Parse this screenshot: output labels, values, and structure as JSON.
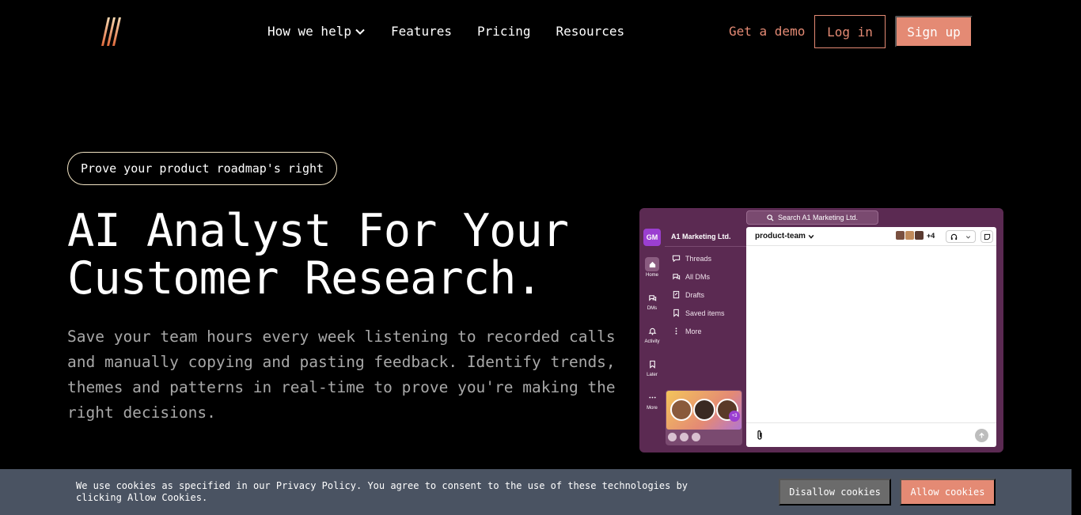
{
  "header": {
    "nav": [
      {
        "label": "How we help"
      },
      {
        "label": "Features"
      },
      {
        "label": "Pricing"
      },
      {
        "label": "Resources"
      }
    ],
    "get_demo": "Get a demo",
    "login": "Log in",
    "signup": "Sign up"
  },
  "hero": {
    "pill": "Prove your product roadmap's right",
    "headline_line1": "AI Analyst For Your",
    "headline_line2": "Customer Research.",
    "subtext": "Save your team hours every week listening to recorded calls and manually copying and pasting feedback. Identify trends, themes and patterns in real-time to prove you're making the right decisions."
  },
  "mockup": {
    "search": "Search A1 Marketing Ltd.",
    "workspace_badge": "GM",
    "workspace_name": "A1 Marketing Ltd.",
    "rail": [
      {
        "label": "Home"
      },
      {
        "label": "DMs"
      },
      {
        "label": "Activity"
      },
      {
        "label": "Later"
      },
      {
        "label": "More"
      }
    ],
    "sidebar": [
      {
        "label": "Threads"
      },
      {
        "label": "All DMs"
      },
      {
        "label": "Drafts"
      },
      {
        "label": "Saved items"
      },
      {
        "label": "More"
      }
    ],
    "huddle_extra": "+3",
    "channel": "product-team",
    "member_count": "+4"
  },
  "cookie": {
    "text": "We use cookies as specified in our Privacy Policy. You agree to consent to the use of these technologies by clicking Allow Cookies.",
    "disallow": "Disallow cookies",
    "allow": "Allow cookies"
  },
  "colors": {
    "accent": "#e48a74",
    "mockup_bg": "#5b2a52",
    "cookie_bg": "#4a5362"
  }
}
